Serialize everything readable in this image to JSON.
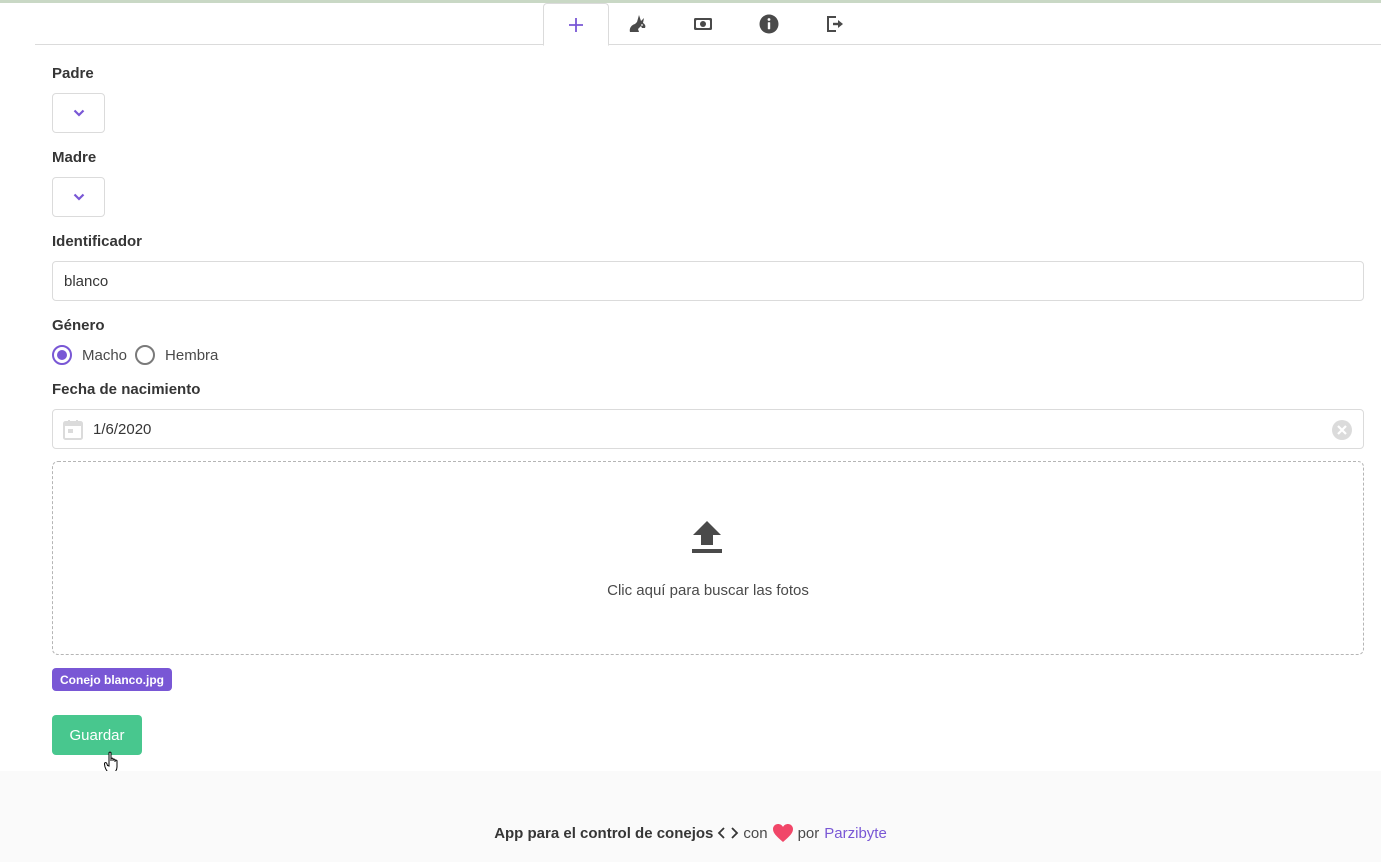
{
  "tabs": [
    {
      "icon": "plus-icon",
      "active": true
    },
    {
      "icon": "rabbit-icon",
      "active": false
    },
    {
      "icon": "money-icon",
      "active": false
    },
    {
      "icon": "info-icon",
      "active": false
    },
    {
      "icon": "logout-icon",
      "active": false
    }
  ],
  "form": {
    "padre_label": "Padre",
    "madre_label": "Madre",
    "identificador_label": "Identificador",
    "identificador_value": "blanco",
    "genero_label": "Género",
    "genero_options": [
      "Macho",
      "Hembra"
    ],
    "genero_selected": "Macho",
    "fecha_label": "Fecha de nacimiento",
    "fecha_value": "1/6/2020",
    "upload_text": "Clic aquí para buscar las fotos",
    "file_tag": "Conejo blanco.jpg",
    "save_label": "Guardar"
  },
  "footer": {
    "app_text": "App para el control de conejos",
    "con": "con",
    "por": "por",
    "author": "Parzibyte"
  },
  "colors": {
    "primary": "#7957d5",
    "success": "#48c78e",
    "heart": "#f14668"
  }
}
